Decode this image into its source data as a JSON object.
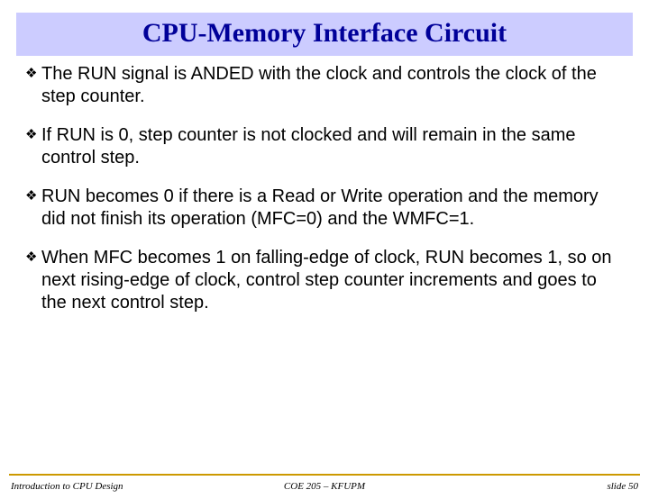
{
  "title": "CPU-Memory Interface Circuit",
  "bullets": [
    "The RUN signal is ANDED with the clock and controls the clock of the step counter.",
    "If RUN is 0, step counter is not clocked and will remain in the same control step.",
    "RUN becomes 0 if there is a Read or Write operation and the memory did not finish its operation (MFC=0) and the WMFC=1.",
    "When MFC becomes 1 on falling-edge of clock, RUN becomes 1, so on next rising-edge of clock, control step counter increments and goes to the next control step."
  ],
  "footer": {
    "left": "Introduction to CPU Design",
    "center": "COE 205 – KFUPM",
    "right": "slide 50"
  }
}
